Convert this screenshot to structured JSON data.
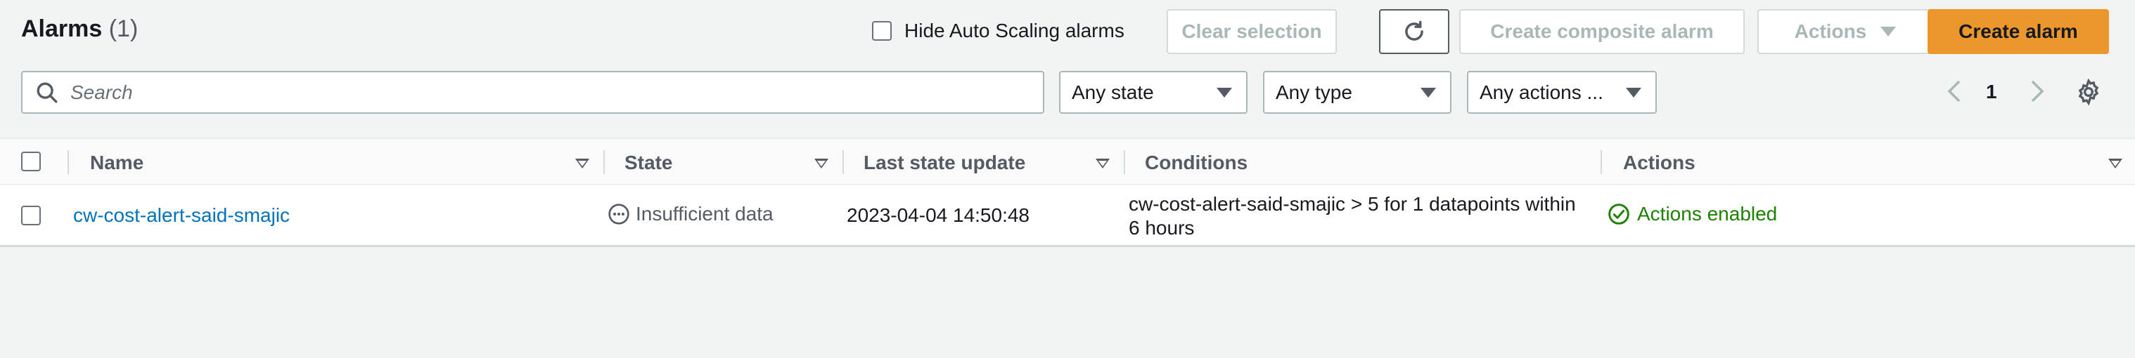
{
  "header": {
    "title": "Alarms",
    "count": "(1)",
    "hide_autoscaling_label": "Hide Auto Scaling alarms",
    "clear_selection": "Clear selection",
    "create_composite": "Create composite alarm",
    "actions": "Actions",
    "create_alarm": "Create alarm"
  },
  "filters": {
    "search_placeholder": "Search",
    "state": "Any state",
    "type": "Any type",
    "actions": "Any actions ..."
  },
  "pagination": {
    "current_page": "1"
  },
  "table": {
    "columns": [
      "Name",
      "State",
      "Last state update",
      "Conditions",
      "Actions"
    ],
    "rows": [
      {
        "name": "cw-cost-alert-said-smajic",
        "state": "Insufficient data",
        "last_update": "2023-04-04 14:50:48",
        "conditions_line1": "cw-cost-alert-said-smajic > 5 for 1 datapoints within",
        "conditions_line2": "6 hours",
        "actions": "Actions enabled"
      }
    ]
  },
  "colors": {
    "primary": "#ec972b",
    "link": "#0073bb",
    "success": "#1d8102",
    "muted": "#545b64",
    "disabled": "#aab7b8"
  },
  "icons": [
    "search-icon",
    "refresh-icon",
    "chevron-left-icon",
    "chevron-right-icon",
    "gear-icon",
    "status-pending-icon",
    "status-check-icon",
    "caret-down-icon"
  ]
}
